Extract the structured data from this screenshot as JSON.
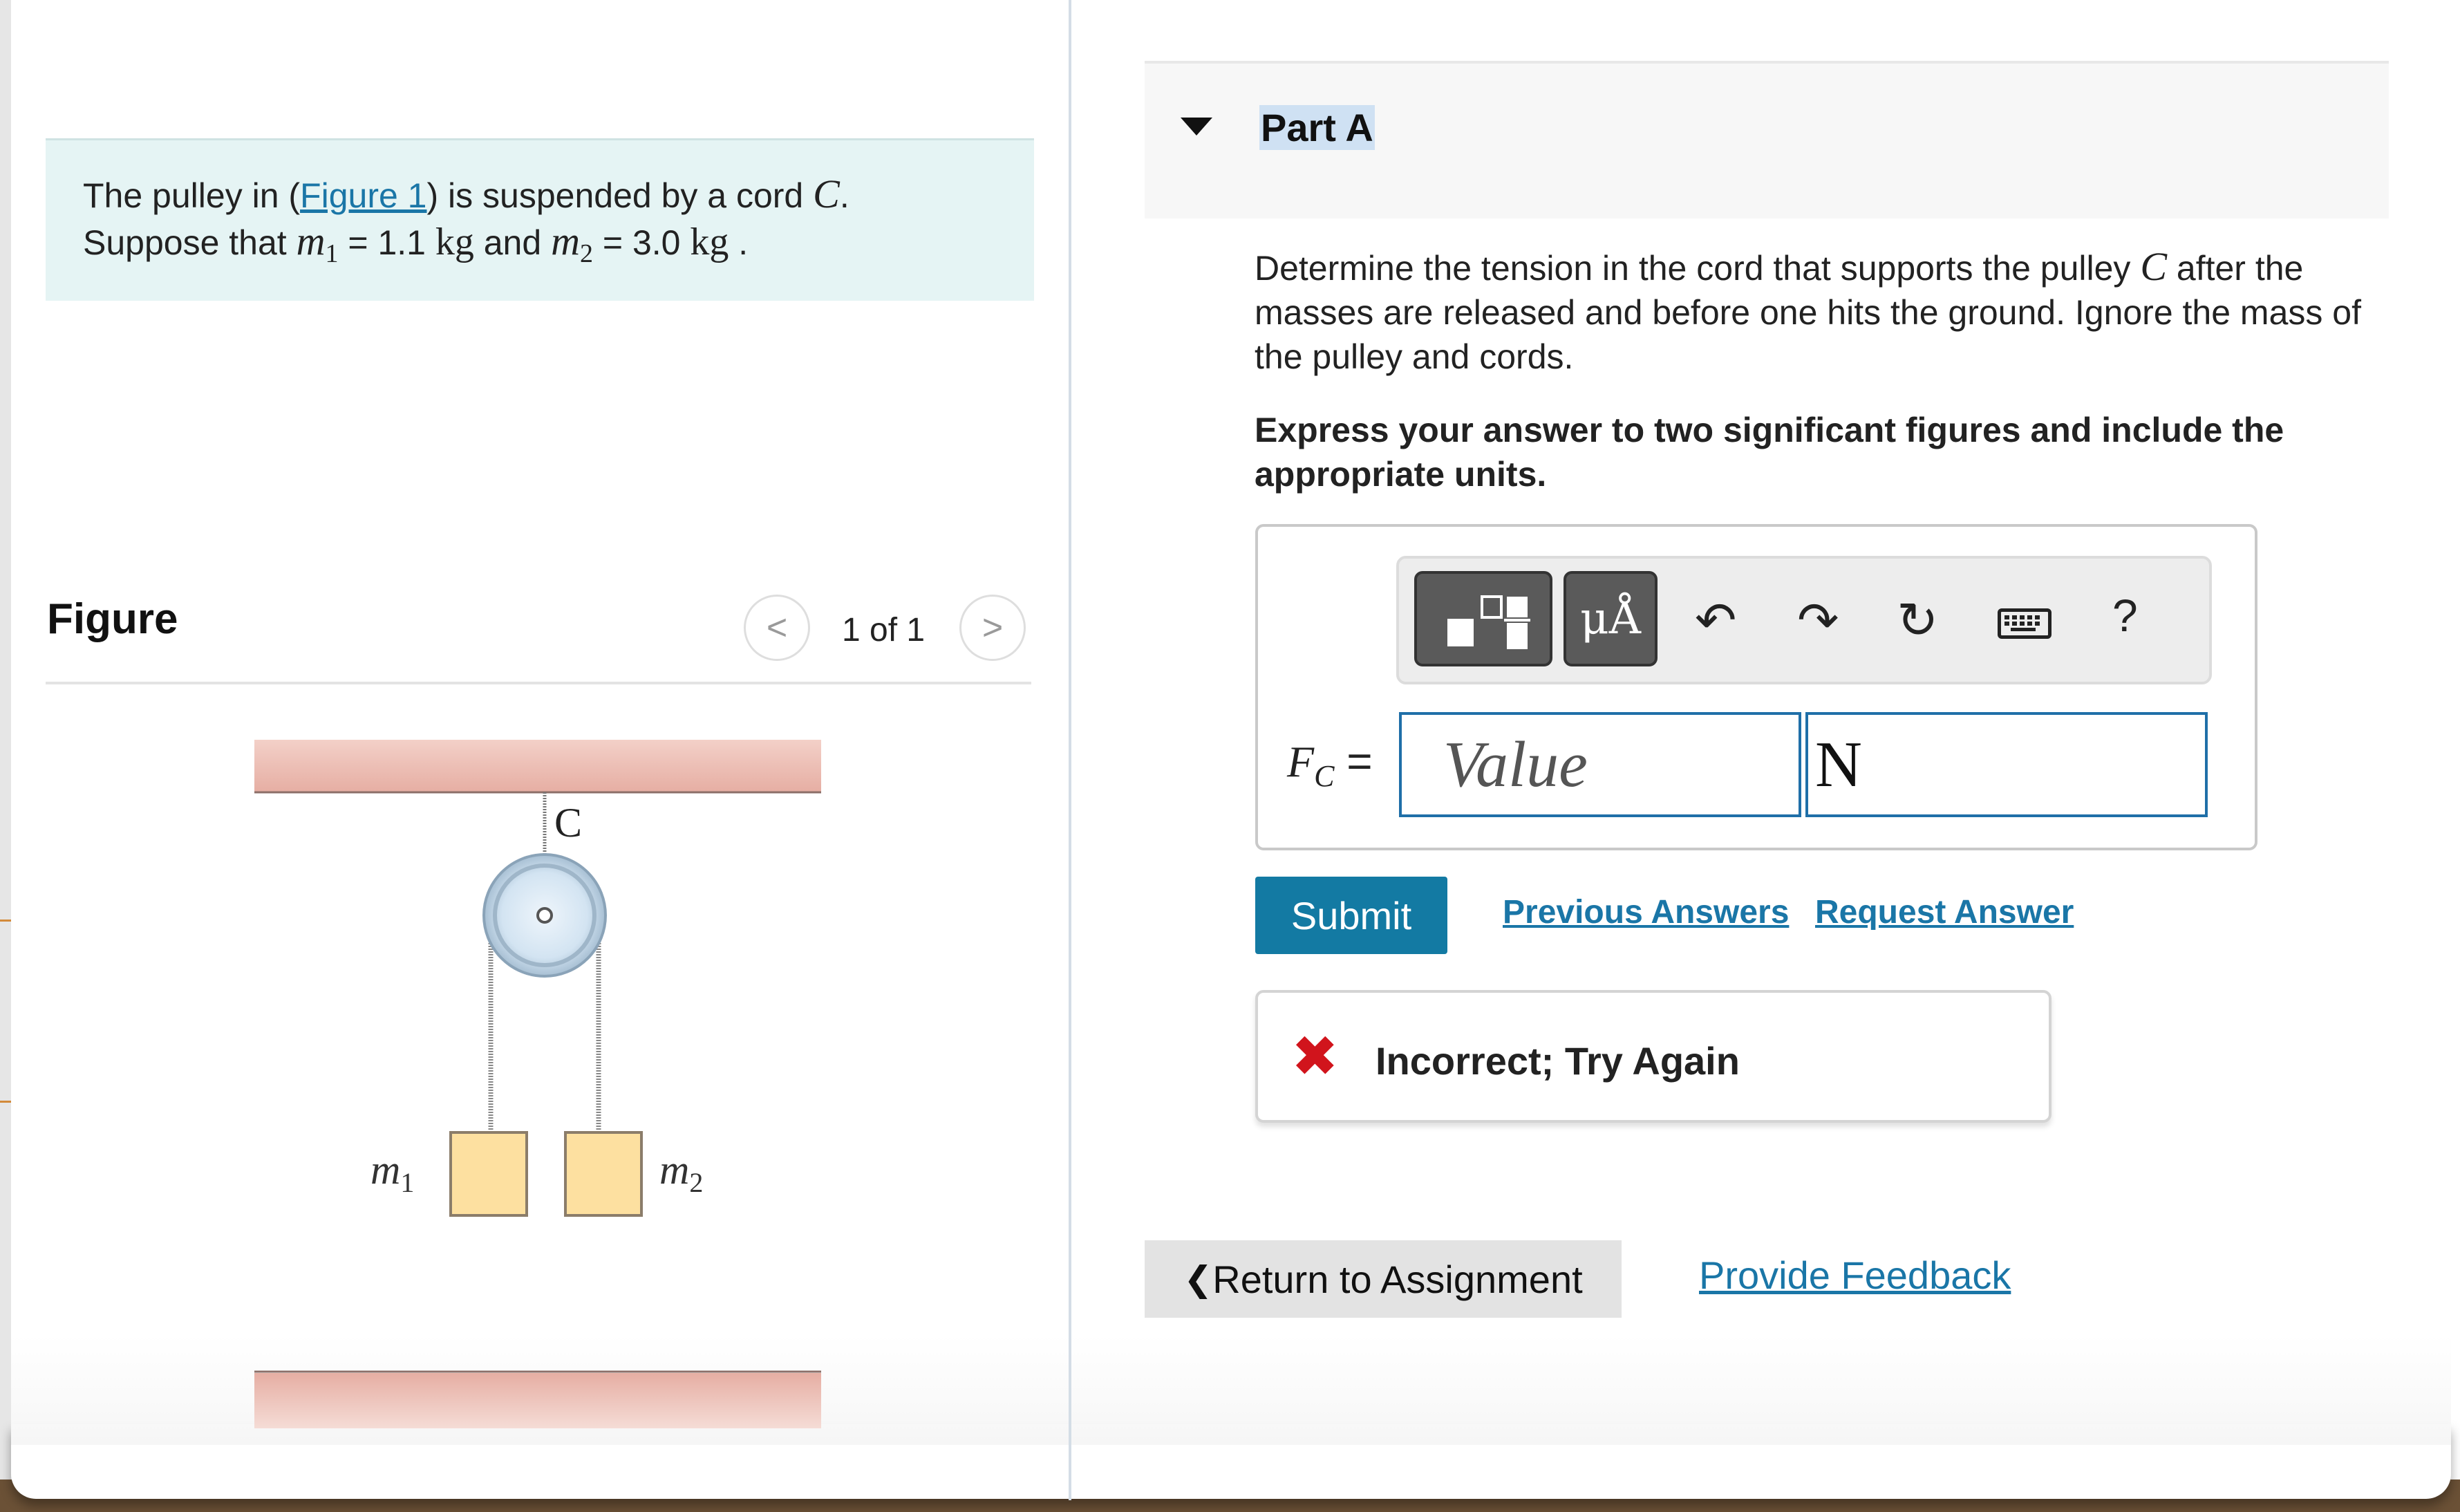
{
  "problem": {
    "text_1": "The pulley in (",
    "figure_link": "Figure 1",
    "text_2": ") is suspended by a cord ",
    "cord_var": "C",
    "text_3": ".",
    "text_4": "Suppose that ",
    "m1_var": "m",
    "m1_sub": "1",
    "m1_value": " = 1.1 ",
    "m1_unit": "kg",
    "text_5": " and ",
    "m2_var": "m",
    "m2_sub": "2",
    "m2_value": " = 3.0 ",
    "m2_unit": "kg",
    "text_6": " ."
  },
  "figure": {
    "title": "Figure",
    "prev_icon": "chevron-left-icon",
    "next_icon": "chevron-right-icon",
    "prev_glyph": "<",
    "next_glyph": ">",
    "page": "1 of 1",
    "labels": {
      "cord": "C",
      "mass1": "m",
      "mass1_sub": "1",
      "mass2": "m",
      "mass2_sub": "2"
    },
    "colors": {
      "ceiling": "#e8b3a9",
      "block": "#fde0a0",
      "pulley": "#cde0f0"
    }
  },
  "part": {
    "title": "Part A",
    "question_1": "Determine the tension in the cord that supports the pulley ",
    "question_var": "C",
    "question_2": " after the masses are released and before one hits the ground. Ignore the mass of the pulley and cords.",
    "instruction": "Express your answer to two significant figures and include the appropriate units."
  },
  "toolbar": {
    "templates_icon": "templates-icon",
    "units_label": "μÅ",
    "undo_glyph": "↶",
    "redo_glyph": "↷",
    "reset_glyph": "↻",
    "help_glyph": "?"
  },
  "answer": {
    "label_var": "F",
    "label_sub": "C",
    "label_eq": " =",
    "value_placeholder": "Value",
    "value": "",
    "unit_value": "N"
  },
  "actions": {
    "submit": "Submit",
    "previous_answers": "Previous Answers",
    "request_answer": "Request Answer"
  },
  "feedback": {
    "icon_glyph": "✖",
    "message": "Incorrect; Try Again"
  },
  "footer": {
    "return_glyph": "❮",
    "return_label": " Return to Assignment",
    "provide_feedback": "Provide Feedback"
  },
  "colors": {
    "accent": "#137aa3",
    "link": "#1a76a7",
    "error": "#d1141c",
    "problem_bg": "#e5f4f4"
  }
}
